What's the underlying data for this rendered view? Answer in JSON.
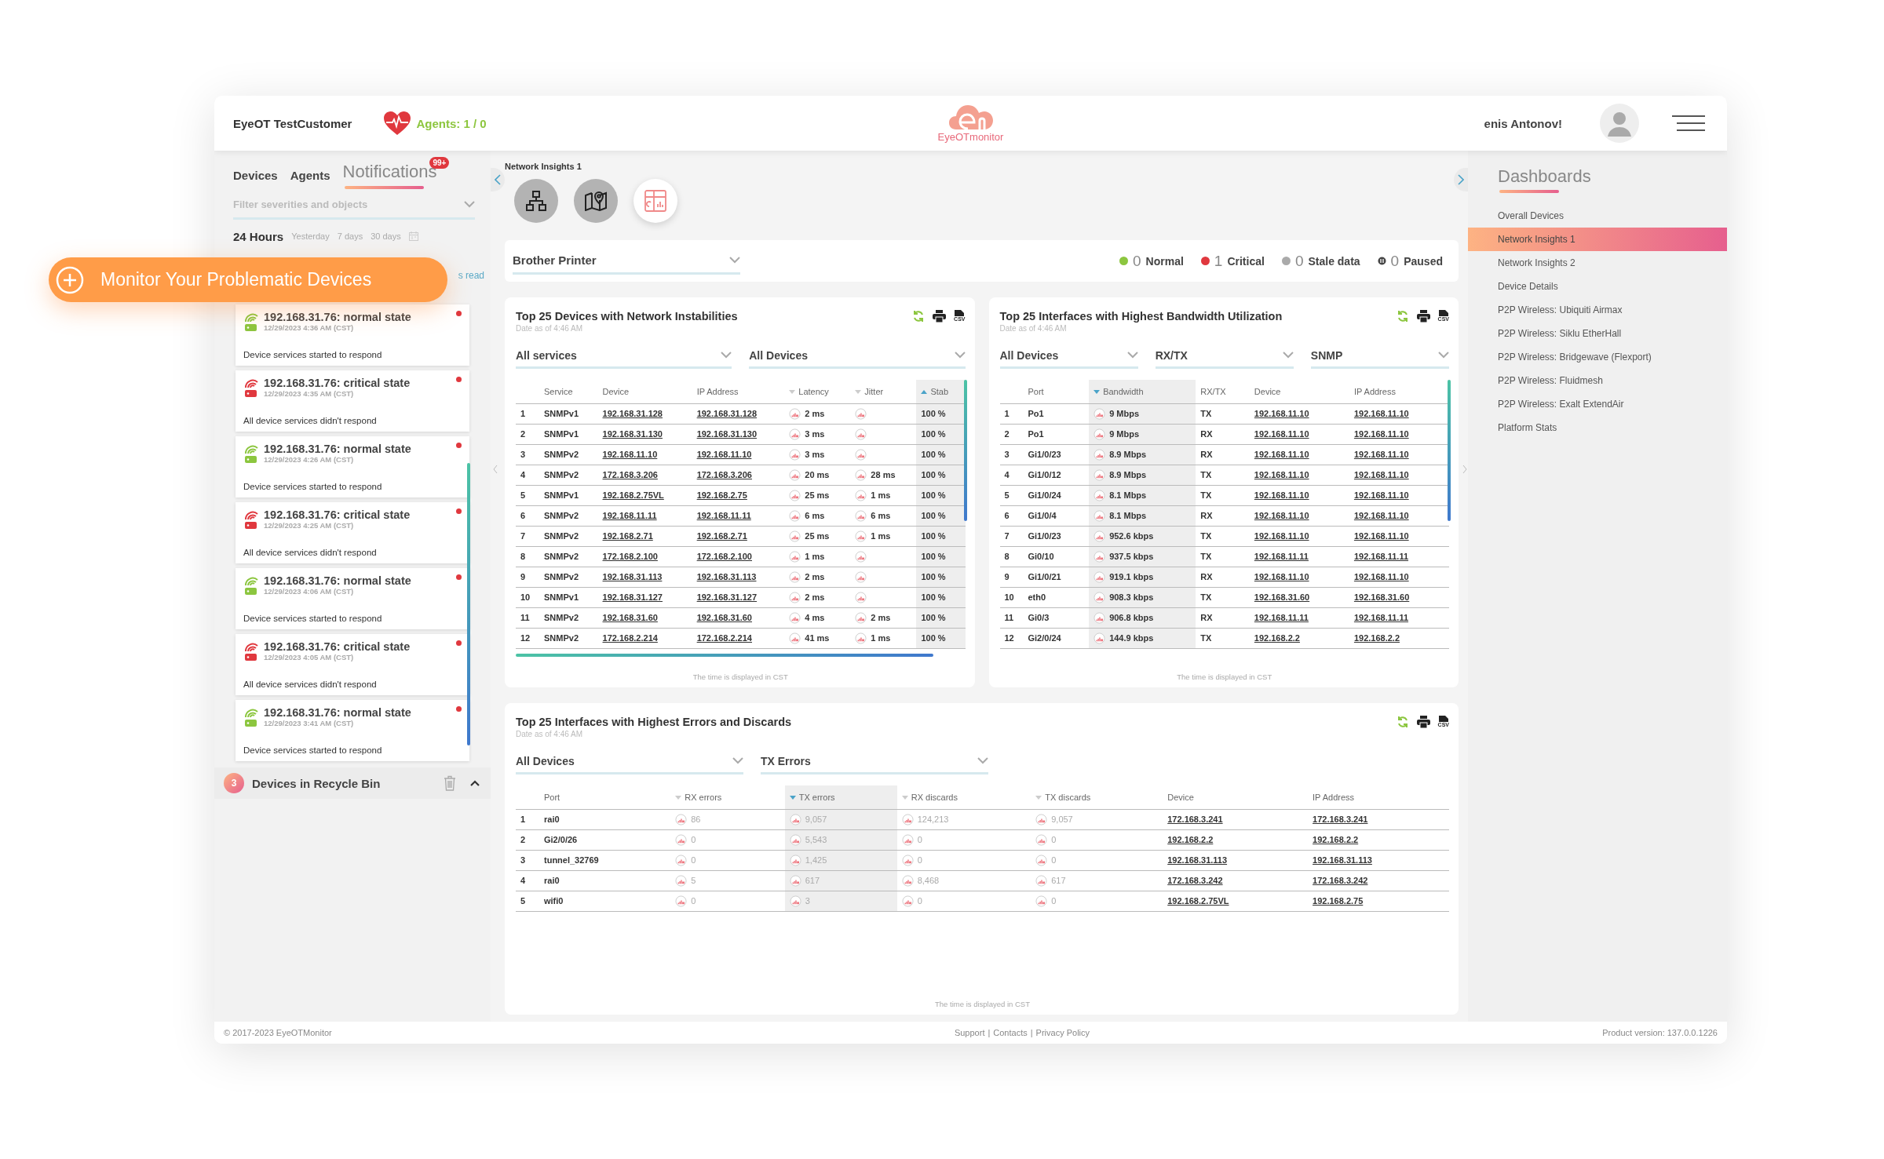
{
  "header": {
    "customer": "EyeOT TestCustomer",
    "agents": "Agents: 1 / 0",
    "logo_text": "EyeOTmonitor",
    "greeting": "enis Antonov!"
  },
  "promo_banner": {
    "label": "Monitor Your Problematic Devices"
  },
  "left_panel": {
    "tabs": [
      {
        "label": "Devices",
        "selected": false
      },
      {
        "label": "Agents",
        "selected": false
      },
      {
        "label": "Notifications",
        "selected": true
      }
    ],
    "notification_badge": "99+",
    "filter": {
      "placeholder": "Filter severities and objects"
    },
    "ranges": [
      {
        "label": "24 Hours",
        "selected": true
      },
      {
        "label": "Yesterday",
        "selected": false
      },
      {
        "label": "7 days",
        "selected": false
      },
      {
        "label": "30 days",
        "selected": false
      }
    ],
    "mark_read": "s read",
    "notifications": [
      {
        "title": "192.168.31.76: normal state",
        "time": "12/29/2023 4:36 AM (CST)",
        "message": "Device services started to respond",
        "kind": "normal",
        "unread": true
      },
      {
        "title": "192.168.31.76: critical state",
        "time": "12/29/2023 4:35 AM (CST)",
        "message": "All device services didn't respond",
        "kind": "critical",
        "unread": true
      },
      {
        "title": "192.168.31.76: normal state",
        "time": "12/29/2023 4:26 AM (CST)",
        "message": "Device services started to respond",
        "kind": "normal",
        "unread": true
      },
      {
        "title": "192.168.31.76: critical state",
        "time": "12/29/2023 4:25 AM (CST)",
        "message": "All device services didn't respond",
        "kind": "critical",
        "unread": true
      },
      {
        "title": "192.168.31.76: normal state",
        "time": "12/29/2023 4:06 AM (CST)",
        "message": "Device services started to respond",
        "kind": "normal",
        "unread": true
      },
      {
        "title": "192.168.31.76: critical state",
        "time": "12/29/2023 4:05 AM (CST)",
        "message": "All device services didn't respond",
        "kind": "critical",
        "unread": true
      },
      {
        "title": "192.168.31.76: normal state",
        "time": "12/29/2023 3:41 AM (CST)",
        "message": "Device services started to respond",
        "kind": "normal",
        "unread": true
      }
    ],
    "recycle_bin": {
      "count": "3",
      "label": "Devices in Recycle Bin"
    }
  },
  "dashboard": {
    "title": "Network Insights 1",
    "views": [
      {
        "kind": "topology",
        "selected": false
      },
      {
        "kind": "map",
        "selected": false
      },
      {
        "kind": "widgets",
        "selected": true
      }
    ],
    "device_filter": "Brother Printer",
    "legend": [
      {
        "count": "0",
        "label": "Normal",
        "kind": "dot",
        "color": "#8cc63f"
      },
      {
        "count": "1",
        "label": "Critical",
        "kind": "dot",
        "color": "#e0383e"
      },
      {
        "count": "0",
        "label": "Stale data",
        "kind": "dot",
        "color": "#aaaaaa"
      },
      {
        "count": "0",
        "label": "Paused",
        "kind": "pause"
      }
    ]
  },
  "widgets": [
    {
      "title": "Top 25 Devices with Network Instabilities",
      "subtitle": "Date as of 4:46 AM",
      "csv_label": "CSV",
      "filters": [
        "All services",
        "All Devices"
      ],
      "columns": [
        {
          "kind": "index",
          "active": false
        },
        {
          "label": "Service",
          "kind": "bold",
          "active": false
        },
        {
          "label": "Device",
          "kind": "link",
          "active": false
        },
        {
          "label": "IP Address",
          "kind": "link",
          "active": false
        },
        {
          "label": "Latency",
          "kind": "gauge",
          "sortable": true,
          "ascending": false,
          "active": false
        },
        {
          "label": "Jitter",
          "kind": "gauge",
          "sortable": true,
          "ascending": false,
          "active": false
        },
        {
          "label": "Stab",
          "kind": "bold",
          "sortable": true,
          "ascending": true,
          "active": true
        }
      ],
      "rows": [
        [
          "1",
          "SNMPv1",
          "192.168.31.128",
          "192.168.31.128",
          "2 ms",
          null,
          "100 %"
        ],
        [
          "2",
          "SNMPv1",
          "192.168.31.130",
          "192.168.31.130",
          "3 ms",
          null,
          "100 %"
        ],
        [
          "3",
          "SNMPv2",
          "192.168.11.10",
          "192.168.11.10",
          "3 ms",
          null,
          "100 %"
        ],
        [
          "4",
          "SNMPv2",
          "172.168.3.206",
          "172.168.3.206",
          "20 ms",
          "28 ms",
          "100 %"
        ],
        [
          "5",
          "SNMPv1",
          "192.168.2.75VL",
          "192.168.2.75",
          "25 ms",
          "1 ms",
          "100 %"
        ],
        [
          "6",
          "SNMPv2",
          "192.168.11.11",
          "192.168.11.11",
          "6 ms",
          "6 ms",
          "100 %"
        ],
        [
          "7",
          "SNMPv2",
          "192.168.2.71",
          "192.168.2.71",
          "25 ms",
          "1 ms",
          "100 %"
        ],
        [
          "8",
          "SNMPv2",
          "172.168.2.100",
          "172.168.2.100",
          "1 ms",
          null,
          "100 %"
        ],
        [
          "9",
          "SNMPv2",
          "192.168.31.113",
          "192.168.31.113",
          "2 ms",
          null,
          "100 %"
        ],
        [
          "10",
          "SNMPv1",
          "192.168.31.127",
          "192.168.31.127",
          "2 ms",
          null,
          "100 %"
        ],
        [
          "11",
          "SNMPv2",
          "192.168.31.60",
          "192.168.31.60",
          "4 ms",
          "2 ms",
          "100 %"
        ],
        [
          "12",
          "SNMPv2",
          "172.168.2.214",
          "172.168.2.214",
          "41 ms",
          "1 ms",
          "100 %"
        ]
      ],
      "note": "The time is displayed in CST"
    },
    {
      "title": "Top 25 Interfaces with Highest Bandwidth Utilization",
      "subtitle": "Date as of 4:46 AM",
      "csv_label": "CSV",
      "filters": [
        "All Devices",
        "RX/TX",
        "SNMP"
      ],
      "columns": [
        {
          "kind": "index",
          "active": false
        },
        {
          "label": "Port",
          "kind": "bold",
          "active": false
        },
        {
          "label": "Bandwidth",
          "kind": "gauge",
          "sortable": true,
          "ascending": false,
          "active": true
        },
        {
          "label": "RX/TX",
          "kind": "bold",
          "active": false
        },
        {
          "label": "Device",
          "kind": "link",
          "active": false
        },
        {
          "label": "IP Address",
          "kind": "link",
          "active": false
        }
      ],
      "rows": [
        [
          "1",
          "Po1",
          "9 Mbps",
          "TX",
          "192.168.11.10",
          "192.168.11.10"
        ],
        [
          "2",
          "Po1",
          "9 Mbps",
          "RX",
          "192.168.11.10",
          "192.168.11.10"
        ],
        [
          "3",
          "Gi1/0/23",
          "8.9 Mbps",
          "RX",
          "192.168.11.10",
          "192.168.11.10"
        ],
        [
          "4",
          "Gi1/0/12",
          "8.9 Mbps",
          "TX",
          "192.168.11.10",
          "192.168.11.10"
        ],
        [
          "5",
          "Gi1/0/24",
          "8.1 Mbps",
          "TX",
          "192.168.11.10",
          "192.168.11.10"
        ],
        [
          "6",
          "Gi1/0/4",
          "8.1 Mbps",
          "RX",
          "192.168.11.10",
          "192.168.11.10"
        ],
        [
          "7",
          "Gi1/0/23",
          "952.6 kbps",
          "TX",
          "192.168.11.10",
          "192.168.11.10"
        ],
        [
          "8",
          "Gi0/10",
          "937.5 kbps",
          "TX",
          "192.168.11.11",
          "192.168.11.11"
        ],
        [
          "9",
          "Gi1/0/21",
          "919.1 kbps",
          "RX",
          "192.168.11.10",
          "192.168.11.10"
        ],
        [
          "10",
          "eth0",
          "908.3 kbps",
          "TX",
          "192.168.31.60",
          "192.168.31.60"
        ],
        [
          "11",
          "Gi0/3",
          "906.8 kbps",
          "RX",
          "192.168.11.11",
          "192.168.11.11"
        ],
        [
          "12",
          "Gi2/0/24",
          "144.9 kbps",
          "TX",
          "192.168.2.2",
          "192.168.2.2"
        ]
      ],
      "note": "The time is displayed in CST"
    },
    {
      "title": "Top 25 Interfaces with Highest Errors and Discards",
      "subtitle": "Date as of 4:46 AM",
      "csv_label": "CSV",
      "filters": [
        "All Devices",
        "TX Errors"
      ],
      "columns": [
        {
          "kind": "index",
          "active": false
        },
        {
          "label": "Port",
          "kind": "bold",
          "active": false
        },
        {
          "label": "RX errors",
          "kind": "gauge-muted",
          "sortable": true,
          "ascending": false,
          "active": false
        },
        {
          "label": "TX errors",
          "kind": "gauge-muted",
          "sortable": true,
          "ascending": false,
          "active": true
        },
        {
          "label": "RX discards",
          "kind": "gauge-muted",
          "sortable": true,
          "ascending": false,
          "active": false
        },
        {
          "label": "TX discards",
          "kind": "gauge-muted",
          "sortable": true,
          "ascending": false,
          "active": false
        },
        {
          "label": "Device",
          "kind": "link",
          "active": false
        },
        {
          "label": "IP Address",
          "kind": "link",
          "active": false
        }
      ],
      "rows": [
        [
          "1",
          "rai0",
          "86",
          "9,057",
          "124,213",
          "9,057",
          "172.168.3.241",
          "172.168.3.241"
        ],
        [
          "2",
          "Gi2/0/26",
          "0",
          "5,543",
          "0",
          "0",
          "192.168.2.2",
          "192.168.2.2"
        ],
        [
          "3",
          "tunnel_32769",
          "0",
          "1,425",
          "0",
          "0",
          "192.168.31.113",
          "192.168.31.113"
        ],
        [
          "4",
          "rai0",
          "5",
          "617",
          "8,468",
          "617",
          "172.168.3.242",
          "172.168.3.242"
        ],
        [
          "5",
          "wifi0",
          "0",
          "3",
          "0",
          "0",
          "192.168.2.75VL",
          "192.168.2.75"
        ]
      ],
      "note": "The time is displayed in CST"
    }
  ],
  "dashboards_panel": {
    "title": "Dashboards",
    "items": [
      {
        "label": "Overall Devices",
        "selected": false
      },
      {
        "label": "Network Insights 1",
        "selected": true
      },
      {
        "label": "Network Insights 2",
        "selected": false
      },
      {
        "label": "Device Details",
        "selected": false
      },
      {
        "label": "P2P Wireless: Ubiquiti Airmax",
        "selected": false
      },
      {
        "label": "P2P Wireless: Siklu EtherHall",
        "selected": false
      },
      {
        "label": "P2P Wireless: Bridgewave (Flexport)",
        "selected": false
      },
      {
        "label": "P2P Wireless: Fluidmesh",
        "selected": false
      },
      {
        "label": "P2P Wireless: Exalt ExtendAir",
        "selected": false
      },
      {
        "label": "Platform Stats",
        "selected": false
      }
    ]
  },
  "footer": {
    "copyright": "© 2017-2023 EyeOTMonitor",
    "links": [
      "Support",
      "Contacts",
      "Privacy Policy"
    ],
    "separator": "|",
    "version": "Product version: 137.0.0.1226"
  }
}
